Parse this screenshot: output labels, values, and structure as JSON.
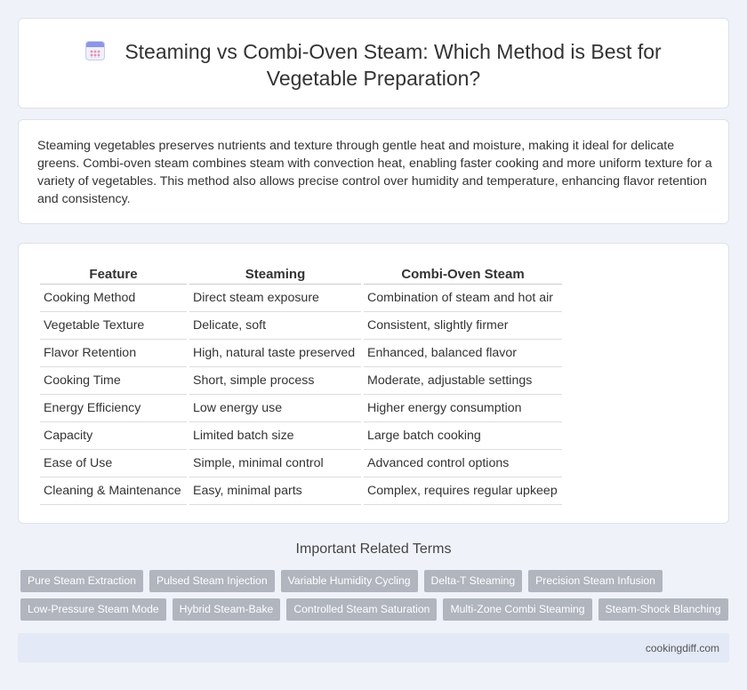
{
  "header": {
    "icon": "calendar-icon",
    "title": "Steaming vs Combi-Oven Steam: Which Method is Best for Vegetable Preparation?"
  },
  "intro": {
    "text": "Steaming vegetables preserves nutrients and texture through gentle heat and moisture, making it ideal for delicate greens. Combi-oven steam combines steam with convection heat, enabling faster cooking and more uniform texture for a variety of vegetables. This method also allows precise control over humidity and temperature, enhancing flavor retention and consistency."
  },
  "table": {
    "headers": [
      "Feature",
      "Steaming",
      "Combi-Oven Steam"
    ],
    "rows": [
      [
        "Cooking Method",
        "Direct steam exposure",
        "Combination of steam and hot air"
      ],
      [
        "Vegetable Texture",
        "Delicate, soft",
        "Consistent, slightly firmer"
      ],
      [
        "Flavor Retention",
        "High, natural taste preserved",
        "Enhanced, balanced flavor"
      ],
      [
        "Cooking Time",
        "Short, simple process",
        "Moderate, adjustable settings"
      ],
      [
        "Energy Efficiency",
        "Low energy use",
        "Higher energy consumption"
      ],
      [
        "Capacity",
        "Limited batch size",
        "Large batch cooking"
      ],
      [
        "Ease of Use",
        "Simple, minimal control",
        "Advanced control options"
      ],
      [
        "Cleaning & Maintenance",
        "Easy, minimal parts",
        "Complex, requires regular upkeep"
      ]
    ]
  },
  "related": {
    "title": "Important Related Terms",
    "row1": [
      "Pure Steam Extraction",
      "Pulsed Steam Injection",
      "Variable Humidity Cycling",
      "Delta-T Steaming",
      "Precision Steam Infusion"
    ],
    "row2": [
      "Low-Pressure Steam Mode",
      "Hybrid Steam-Bake",
      "Controlled Steam Saturation",
      "Multi-Zone Combi Steaming",
      "Steam-Shock Blanching"
    ]
  },
  "footer": {
    "site": "cookingdiff.com"
  },
  "colors": {
    "background": "#eff2f8",
    "tag": "#b0b5be",
    "footer": "#e3e9f6"
  }
}
